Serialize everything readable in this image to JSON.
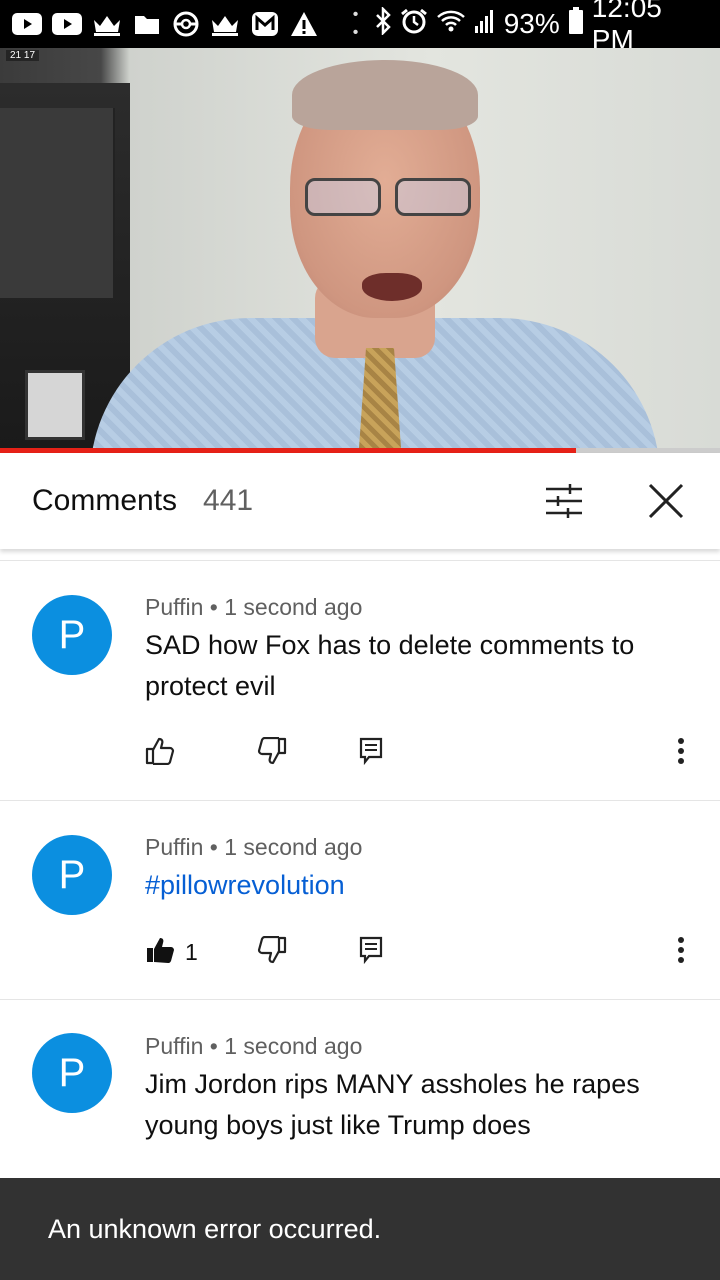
{
  "status_bar": {
    "battery": "93%",
    "time": "12:05 PM",
    "dots": "• •"
  },
  "video": {
    "progress_percent": 80,
    "overlay_tag": "21  17"
  },
  "comments_header": {
    "title": "Comments",
    "count": "441"
  },
  "comments": [
    {
      "avatar_letter": "P",
      "author": "Puffin",
      "time": "1 second ago",
      "text": "SAD how Fox has to delete comments to protect evil",
      "likes": "",
      "is_hashtag": false
    },
    {
      "avatar_letter": "P",
      "author": "Puffin",
      "time": "1 second ago",
      "text": "#pillowrevolution",
      "likes": "1",
      "is_hashtag": true
    },
    {
      "avatar_letter": "P",
      "author": "Puffin",
      "time": "1 second ago",
      "text": "Jim Jordon rips MANY assholes he rapes young boys just like Trump does",
      "likes": "",
      "is_hashtag": false
    }
  ],
  "snackbar": {
    "message": "An unknown error occurred."
  },
  "colors": {
    "avatar": "#0b8fe0",
    "hashtag": "#065fd4",
    "progress": "#e62117",
    "snackbar": "#323232"
  },
  "icons": [
    "youtube-icon",
    "crown-icon",
    "folder-icon",
    "pokeball-icon",
    "gmail-icon",
    "warning-icon",
    "bluetooth-icon",
    "alarm-icon",
    "wifi-icon",
    "signal-icon",
    "battery-icon",
    "sort-filter-icon",
    "close-icon",
    "thumbs-up-icon",
    "thumbs-down-icon",
    "reply-icon",
    "more-vert-icon"
  ]
}
